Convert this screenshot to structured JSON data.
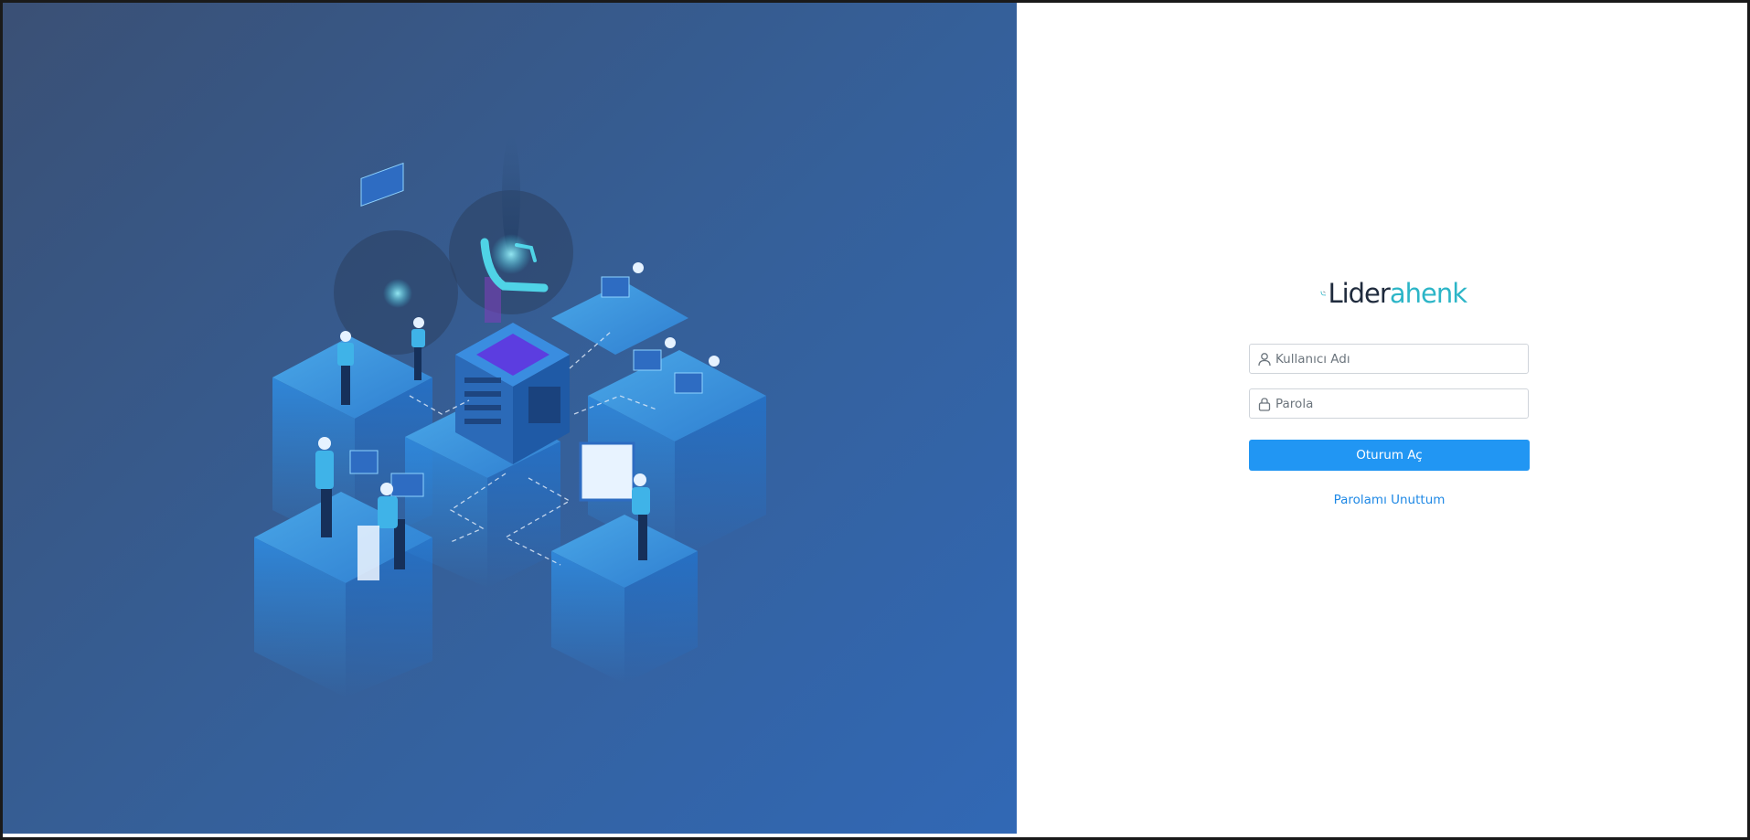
{
  "brand": {
    "name_part1": "Lider",
    "name_part2": "ahenk",
    "teal": "#2cb5c7",
    "dark": "#1f2b3d"
  },
  "login": {
    "username_placeholder": "Kullanıcı Adı",
    "username_value": "",
    "password_placeholder": "Parola",
    "password_value": "",
    "submit_label": "Oturum Aç",
    "forgot_label": "Parolamı Unuttum",
    "accent_color": "#2196f3",
    "link_color": "#1e88e5"
  },
  "icons": {
    "username": "user-icon",
    "password": "lock-icon"
  }
}
